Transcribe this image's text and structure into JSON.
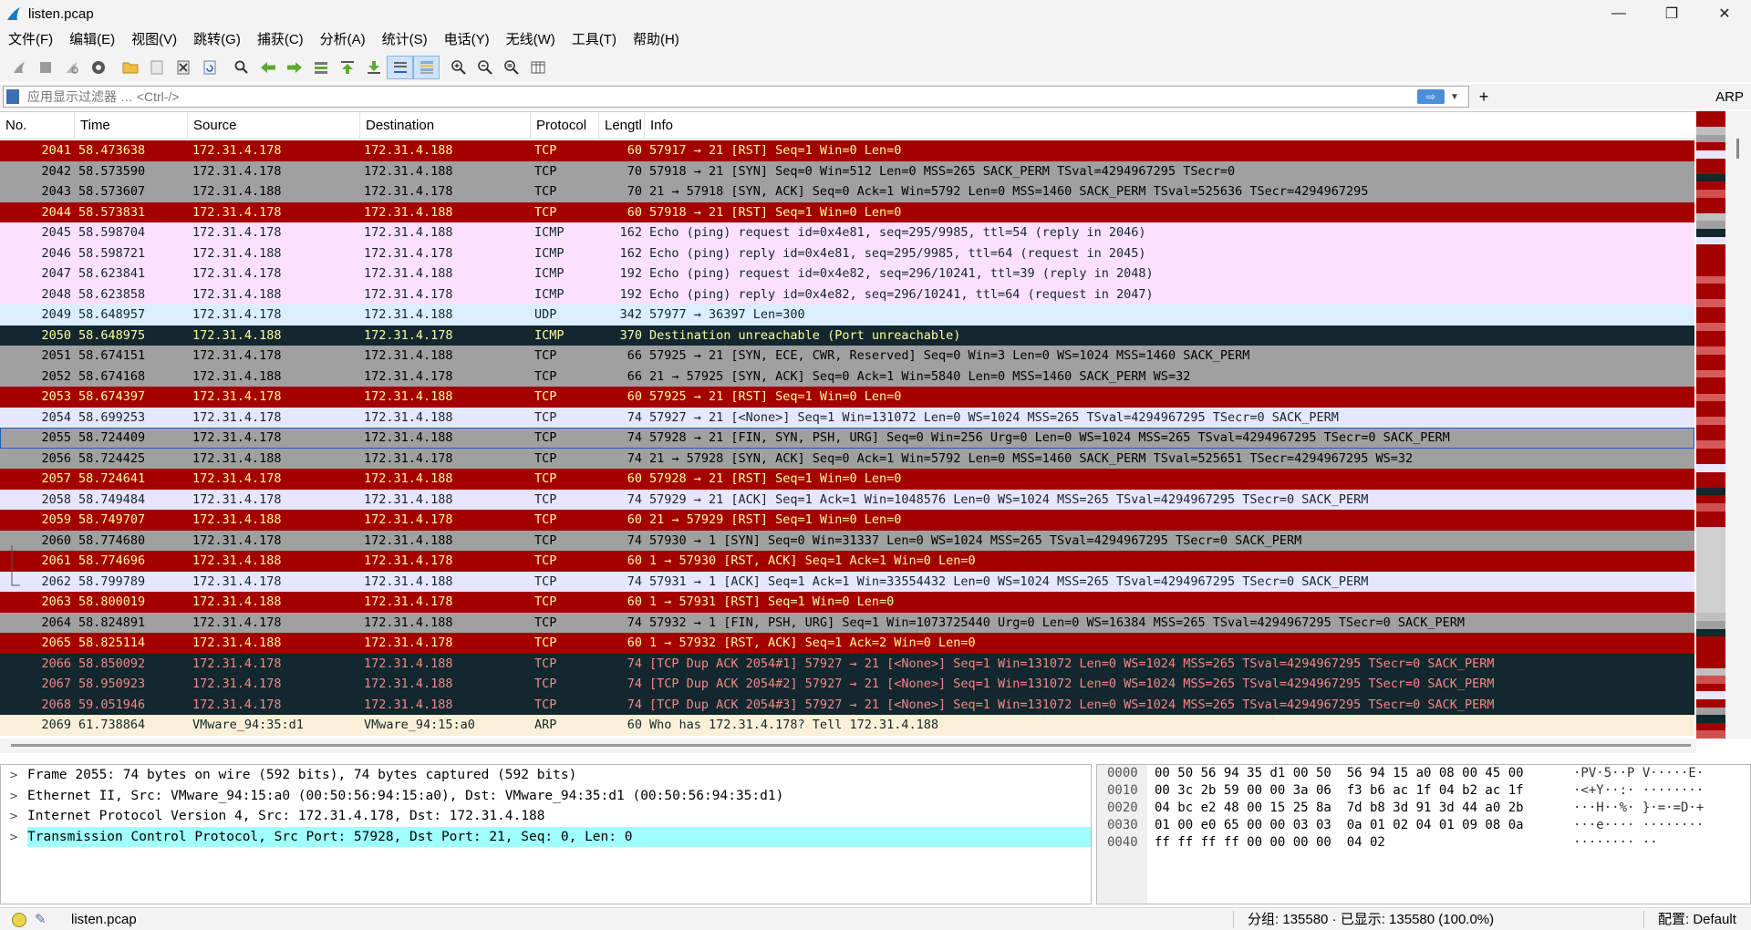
{
  "window": {
    "title": "listen.pcap",
    "minimize": "—",
    "restore": "❐",
    "close": "✕"
  },
  "menu": [
    "文件(F)",
    "编辑(E)",
    "视图(V)",
    "跳转(G)",
    "捕获(C)",
    "分析(A)",
    "统计(S)",
    "电话(Y)",
    "无线(W)",
    "工具(T)",
    "帮助(H)"
  ],
  "toolbar_icons": [
    "start-capture-icon",
    "stop-capture-icon",
    "restart-capture-icon",
    "capture-options-icon",
    "open-file-icon",
    "save-file-icon",
    "close-file-icon",
    "reload-file-icon",
    "find-packet-icon",
    "go-back-icon",
    "go-forward-icon",
    "go-to-packet-icon",
    "go-first-icon",
    "go-last-icon",
    "autoscroll-icon",
    "colorize-icon",
    "zoom-in-icon",
    "zoom-out-icon",
    "zoom-normal-icon",
    "resize-columns-icon"
  ],
  "filter": {
    "placeholder": "应用显示过滤器 … <Ctrl-/>",
    "arrow": "⇨",
    "add": "+",
    "arp_button": "ARP"
  },
  "columns": [
    "No.",
    "Time",
    "Source",
    "Destination",
    "Protocol",
    "Lengtl",
    "Info"
  ],
  "packets": [
    {
      "no": "2041",
      "time": "58.473638",
      "src": "172.31.4.178",
      "dst": "172.31.4.188",
      "proto": "TCP",
      "len": "60",
      "info": "57917 → 21 [RST] Seq=1 Win=0 Len=0",
      "style": "red"
    },
    {
      "no": "2042",
      "time": "58.573590",
      "src": "172.31.4.178",
      "dst": "172.31.4.188",
      "proto": "TCP",
      "len": "70",
      "info": "57918 → 21 [SYN] Seq=0 Win=512 Len=0 MSS=265 SACK_PERM TSval=4294967295 TSecr=0",
      "style": "gray"
    },
    {
      "no": "2043",
      "time": "58.573607",
      "src": "172.31.4.188",
      "dst": "172.31.4.178",
      "proto": "TCP",
      "len": "70",
      "info": "21 → 57918 [SYN, ACK] Seq=0 Ack=1 Win=5792 Len=0 MSS=1460 SACK_PERM TSval=525636 TSecr=4294967295",
      "style": "gray"
    },
    {
      "no": "2044",
      "time": "58.573831",
      "src": "172.31.4.178",
      "dst": "172.31.4.188",
      "proto": "TCP",
      "len": "60",
      "info": "57918 → 21 [RST] Seq=1 Win=0 Len=0",
      "style": "red"
    },
    {
      "no": "2045",
      "time": "58.598704",
      "src": "172.31.4.178",
      "dst": "172.31.4.188",
      "proto": "ICMP",
      "len": "162",
      "info": "Echo (ping) request  id=0x4e81, seq=295/9985, ttl=54 (reply in 2046)",
      "style": "icmp"
    },
    {
      "no": "2046",
      "time": "58.598721",
      "src": "172.31.4.188",
      "dst": "172.31.4.178",
      "proto": "ICMP",
      "len": "162",
      "info": "Echo (ping) reply    id=0x4e81, seq=295/9985, ttl=64 (request in 2045)",
      "style": "icmp"
    },
    {
      "no": "2047",
      "time": "58.623841",
      "src": "172.31.4.178",
      "dst": "172.31.4.188",
      "proto": "ICMP",
      "len": "192",
      "info": "Echo (ping) request  id=0x4e82, seq=296/10241, ttl=39 (reply in 2048)",
      "style": "icmp"
    },
    {
      "no": "2048",
      "time": "58.623858",
      "src": "172.31.4.188",
      "dst": "172.31.4.178",
      "proto": "ICMP",
      "len": "192",
      "info": "Echo (ping) reply    id=0x4e82, seq=296/10241, ttl=64 (request in 2047)",
      "style": "icmp"
    },
    {
      "no": "2049",
      "time": "58.648957",
      "src": "172.31.4.178",
      "dst": "172.31.4.188",
      "proto": "UDP",
      "len": "342",
      "info": "57977 → 36397 Len=300",
      "style": "udp"
    },
    {
      "no": "2050",
      "time": "58.648975",
      "src": "172.31.4.188",
      "dst": "172.31.4.178",
      "proto": "ICMP",
      "len": "370",
      "info": "Destination unreachable (Port unreachable)",
      "style": "dark"
    },
    {
      "no": "2051",
      "time": "58.674151",
      "src": "172.31.4.178",
      "dst": "172.31.4.188",
      "proto": "TCP",
      "len": "66",
      "info": "57925 → 21 [SYN, ECE, CWR, Reserved] Seq=0 Win=3 Len=0 WS=1024 MSS=1460 SACK_PERM",
      "style": "gray"
    },
    {
      "no": "2052",
      "time": "58.674168",
      "src": "172.31.4.188",
      "dst": "172.31.4.178",
      "proto": "TCP",
      "len": "66",
      "info": "21 → 57925 [SYN, ACK] Seq=0 Ack=1 Win=5840 Len=0 MSS=1460 SACK_PERM WS=32",
      "style": "gray"
    },
    {
      "no": "2053",
      "time": "58.674397",
      "src": "172.31.4.178",
      "dst": "172.31.4.188",
      "proto": "TCP",
      "len": "60",
      "info": "57925 → 21 [RST] Seq=1 Win=0 Len=0",
      "style": "red"
    },
    {
      "no": "2054",
      "time": "58.699253",
      "src": "172.31.4.178",
      "dst": "172.31.4.188",
      "proto": "TCP",
      "len": "74",
      "info": "57927 → 21 [<None>] Seq=1 Win=131072 Len=0 WS=1024 MSS=265 TSval=4294967295 TSecr=0 SACK_PERM",
      "style": "lav"
    },
    {
      "no": "2055",
      "time": "58.724409",
      "src": "172.31.4.178",
      "dst": "172.31.4.188",
      "proto": "TCP",
      "len": "74",
      "info": "57928 → 21 [FIN, SYN, PSH, URG] Seq=0 Win=256 Urg=0 Len=0 WS=1024 MSS=265 TSval=4294967295 TSecr=0 SACK_PERM",
      "style": "sel"
    },
    {
      "no": "2056",
      "time": "58.724425",
      "src": "172.31.4.188",
      "dst": "172.31.4.178",
      "proto": "TCP",
      "len": "74",
      "info": "21 → 57928 [SYN, ACK] Seq=0 Ack=1 Win=5792 Len=0 MSS=1460 SACK_PERM TSval=525651 TSecr=4294967295 WS=32",
      "style": "gray"
    },
    {
      "no": "2057",
      "time": "58.724641",
      "src": "172.31.4.178",
      "dst": "172.31.4.188",
      "proto": "TCP",
      "len": "60",
      "info": "57928 → 21 [RST] Seq=1 Win=0 Len=0",
      "style": "red"
    },
    {
      "no": "2058",
      "time": "58.749484",
      "src": "172.31.4.178",
      "dst": "172.31.4.188",
      "proto": "TCP",
      "len": "74",
      "info": "57929 → 21 [ACK] Seq=1 Ack=1 Win=1048576 Len=0 WS=1024 MSS=265 TSval=4294967295 TSecr=0 SACK_PERM",
      "style": "lav"
    },
    {
      "no": "2059",
      "time": "58.749707",
      "src": "172.31.4.188",
      "dst": "172.31.4.178",
      "proto": "TCP",
      "len": "60",
      "info": "21 → 57929 [RST] Seq=1 Win=0 Len=0",
      "style": "red"
    },
    {
      "no": "2060",
      "time": "58.774680",
      "src": "172.31.4.178",
      "dst": "172.31.4.188",
      "proto": "TCP",
      "len": "74",
      "info": "57930 → 1 [SYN] Seq=0 Win=31337 Len=0 WS=1024 MSS=265 TSval=4294967295 TSecr=0 SACK_PERM",
      "style": "gray"
    },
    {
      "no": "2061",
      "time": "58.774696",
      "src": "172.31.4.188",
      "dst": "172.31.4.178",
      "proto": "TCP",
      "len": "60",
      "info": "1 → 57930 [RST, ACK] Seq=1 Ack=1 Win=0 Len=0",
      "style": "red"
    },
    {
      "no": "2062",
      "time": "58.799789",
      "src": "172.31.4.178",
      "dst": "172.31.4.188",
      "proto": "TCP",
      "len": "74",
      "info": "57931 → 1 [ACK] Seq=1 Ack=1 Win=33554432 Len=0 WS=1024 MSS=265 TSval=4294967295 TSecr=0 SACK_PERM",
      "style": "lav"
    },
    {
      "no": "2063",
      "time": "58.800019",
      "src": "172.31.4.188",
      "dst": "172.31.4.178",
      "proto": "TCP",
      "len": "60",
      "info": "1 → 57931 [RST] Seq=1 Win=0 Len=0",
      "style": "red"
    },
    {
      "no": "2064",
      "time": "58.824891",
      "src": "172.31.4.178",
      "dst": "172.31.4.188",
      "proto": "TCP",
      "len": "74",
      "info": "57932 → 1 [FIN, PSH, URG] Seq=1 Win=1073725440 Urg=0 Len=0 WS=16384 MSS=265 TSval=4294967295 TSecr=0 SACK_PERM",
      "style": "gray"
    },
    {
      "no": "2065",
      "time": "58.825114",
      "src": "172.31.4.188",
      "dst": "172.31.4.178",
      "proto": "TCP",
      "len": "60",
      "info": "1 → 57932 [RST, ACK] Seq=1 Ack=2 Win=0 Len=0",
      "style": "red"
    },
    {
      "no": "2066",
      "time": "58.850092",
      "src": "172.31.4.178",
      "dst": "172.31.4.188",
      "proto": "TCP",
      "len": "74",
      "info": "[TCP Dup ACK 2054#1] 57927 → 21 [<None>] Seq=1 Win=131072 Len=0 WS=1024 MSS=265 TSval=4294967295 TSecr=0 SACK_PERM",
      "style": "dup"
    },
    {
      "no": "2067",
      "time": "58.950923",
      "src": "172.31.4.178",
      "dst": "172.31.4.188",
      "proto": "TCP",
      "len": "74",
      "info": "[TCP Dup ACK 2054#2] 57927 → 21 [<None>] Seq=1 Win=131072 Len=0 WS=1024 MSS=265 TSval=4294967295 TSecr=0 SACK_PERM",
      "style": "dup"
    },
    {
      "no": "2068",
      "time": "59.051946",
      "src": "172.31.4.178",
      "dst": "172.31.4.188",
      "proto": "TCP",
      "len": "74",
      "info": "[TCP Dup ACK 2054#3] 57927 → 21 [<None>] Seq=1 Win=131072 Len=0 WS=1024 MSS=265 TSval=4294967295 TSecr=0 SACK_PERM",
      "style": "dup"
    },
    {
      "no": "2069",
      "time": "61.738864",
      "src": "VMware_94:35:d1",
      "dst": "VMware_94:15:a0",
      "proto": "ARP",
      "len": "60",
      "info": "Who has 172.31.4.178? Tell 172.31.4.188",
      "style": "arp"
    }
  ],
  "details": [
    "Frame 2055: 74 bytes on wire (592 bits), 74 bytes captured (592 bits)",
    "Ethernet II, Src: VMware_94:15:a0 (00:50:56:94:15:a0), Dst: VMware_94:35:d1 (00:50:56:94:35:d1)",
    "Internet Protocol Version 4, Src: 172.31.4.178, Dst: 172.31.4.188",
    "Transmission Control Protocol, Src Port: 57928, Dst Port: 21, Seq: 0, Len: 0"
  ],
  "hex": [
    {
      "off": "0000",
      "bytes": "00 50 56 94 35 d1 00 50  56 94 15 a0 08 00 45 00",
      "ascii": "·PV·5··P V·····E·"
    },
    {
      "off": "0010",
      "bytes": "00 3c 2b 59 00 00 3a 06  f3 b6 ac 1f 04 b2 ac 1f",
      "ascii": "·<+Y··:· ········"
    },
    {
      "off": "0020",
      "bytes": "04 bc e2 48 00 15 25 8a  7d b8 3d 91 3d 44 a0 2b",
      "ascii": "···H··%· }·=·=D·+"
    },
    {
      "off": "0030",
      "bytes": "01 00 e0 65 00 00 03 03  0a 01 02 04 01 09 08 0a",
      "ascii": "···e···· ········"
    },
    {
      "off": "0040",
      "bytes": "ff ff ff ff 00 00 00 00  04 02",
      "ascii": "········ ··"
    }
  ],
  "status": {
    "file": "listen.pcap",
    "counts": "分组: 135580 · 已显示: 135580 (100.0%)",
    "profile": "配置: Default"
  },
  "colors": {
    "red": "#a40000",
    "gray": "#a0a0a0",
    "icmp": "#fce0ff",
    "udp": "#daeeff",
    "dark": "#12272e",
    "lav": "#e7e6ff",
    "arp": "#faf0d7",
    "selected_outline": "#1960bd",
    "detail_highlight": "#a0ffff"
  }
}
